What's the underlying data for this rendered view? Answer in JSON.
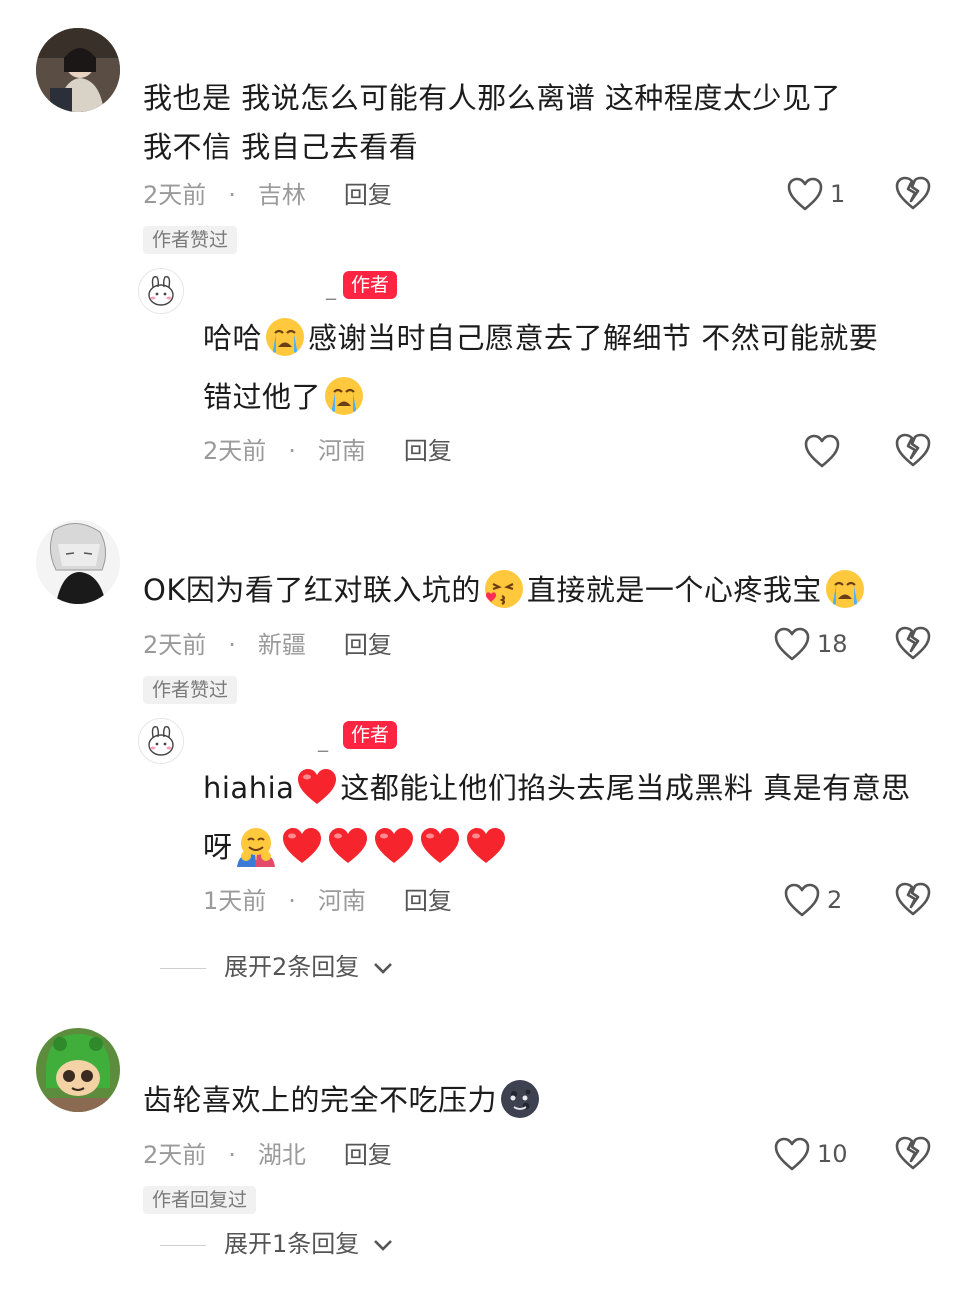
{
  "comments": [
    {
      "line1": "我也是  我说怎么可能有人那么离谱    这种程度太少见了",
      "line2": "我不信  我自己去看看",
      "time": "2天前",
      "dot": "·",
      "location": "吉林",
      "reply": "回复",
      "likes": "1",
      "badge": "作者赞过"
    },
    {
      "line1": "OK因为看了红对联入坑的",
      "line1b": "直接就是一个心疼我宝",
      "time": "2天前",
      "dot": "·",
      "location": "新疆",
      "reply": "回复",
      "likes": "18",
      "badge": "作者赞过"
    },
    {
      "line1": "齿轮喜欢上的完全不吃压力",
      "time": "2天前",
      "dot": "·",
      "location": "湖北",
      "reply": "回复",
      "likes": "10",
      "badge": "作者回复过"
    }
  ],
  "replies": [
    {
      "author_name": "_",
      "author_badge": "作者",
      "line1a": "哈哈",
      "line1b": "感谢当时自己愿意去了解细节  不然可能就要",
      "line2": "错过他了",
      "time": "2天前",
      "dot": "·",
      "location": "河南",
      "reply": "回复",
      "likes": ""
    },
    {
      "author_name": "_",
      "author_badge": "作者",
      "line1a": "hiahia",
      "line1b": "这都能让他们掐头去尾当成黑料  真是有意思",
      "line2": "呀",
      "time": "1天前",
      "dot": "·",
      "location": "河南",
      "reply": "回复",
      "likes": "2"
    }
  ],
  "expand": [
    {
      "label": "展开2条回复"
    },
    {
      "label": "展开1条回复"
    }
  ],
  "colors": {
    "author_badge": "#ff2442",
    "muted": "#9a9a9a"
  }
}
